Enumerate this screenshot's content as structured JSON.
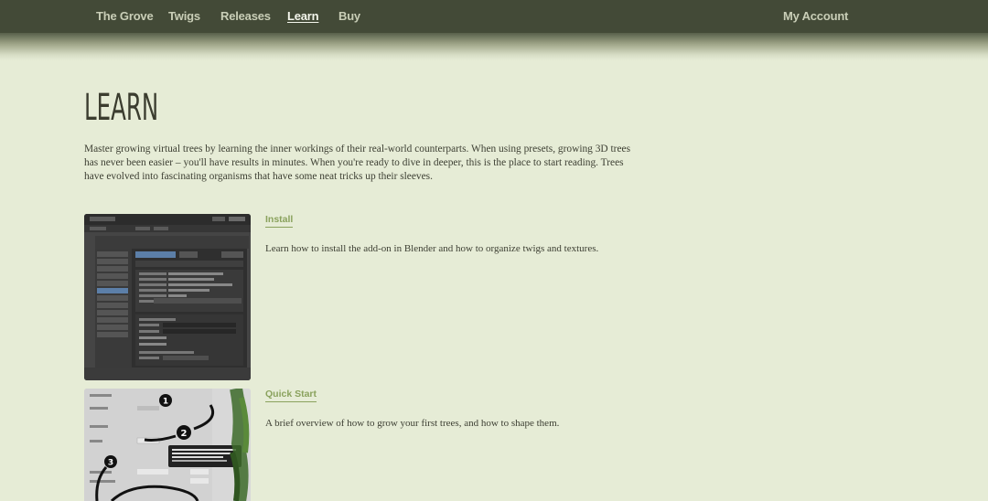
{
  "nav": {
    "brand": "The Grove",
    "items": [
      "Twigs",
      "Releases",
      "Learn",
      "Buy"
    ],
    "active": "Learn",
    "account": "My Account"
  },
  "page": {
    "title": "LEARN",
    "intro": "Master growing virtual trees by learning the inner workings of their real-world counterparts. When using presets, growing 3D trees has never been easier – you'll have results in minutes. When you're ready to dive in deeper, this is the place to start reading. Trees have evolved into fascinating organisms that have some neat tricks up their sleeves."
  },
  "cards": [
    {
      "title": "Install",
      "description": "Learn how to install the add-on in Blender and how to organize twigs and textures."
    },
    {
      "title": "Quick Start",
      "description": "A brief overview of how to grow your first trees, and how to shape them."
    }
  ],
  "colors": {
    "nav_bg": "#434a37",
    "page_bg": "#e6ecd6",
    "accent": "#8aa25d",
    "text": "#3d3f33"
  }
}
